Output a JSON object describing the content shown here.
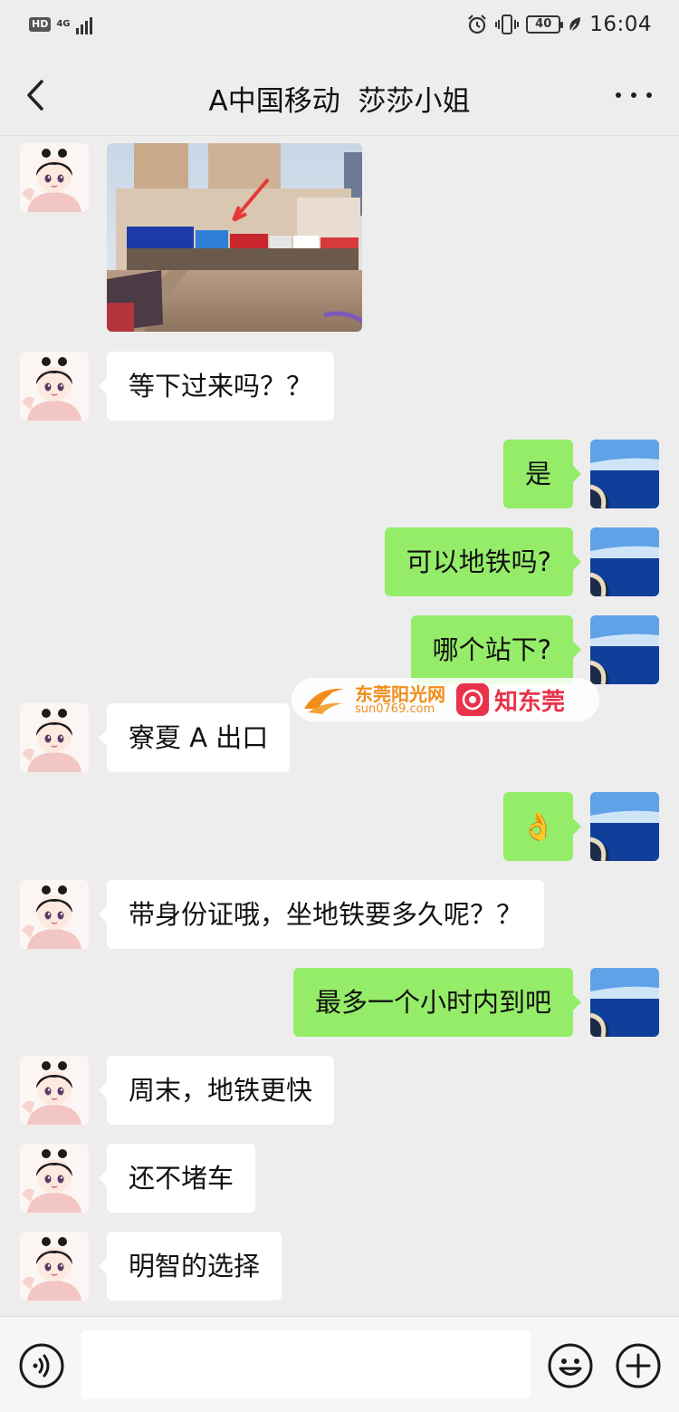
{
  "status_bar": {
    "hd": "HD",
    "network": "4G",
    "battery": "40",
    "time": "16:04"
  },
  "header": {
    "title": "A中国移动  莎莎小姐"
  },
  "messages": {
    "m2": "等下过来吗？？",
    "m3": "是",
    "m4": "可以地铁吗?",
    "m5": "哪个站下?",
    "m6": "寮夏 A 出口",
    "m7": "👌",
    "m8": "带身份证哦，坐地铁要多久呢？？",
    "m9": "最多一个小时内到吧",
    "m10": "周末，地铁更快",
    "m11": "还不堵车",
    "m12": "明智的选择"
  },
  "watermark": {
    "site": "东莞阳光网",
    "url": "sun0769.com",
    "brand": "知东莞"
  },
  "input": {
    "value": "",
    "placeholder": ""
  },
  "colors": {
    "background": "#ededed",
    "incoming_bubble": "#ffffff",
    "outgoing_bubble": "#95ec69",
    "watermark_orange": "#f28c1a",
    "watermark_red": "#e8334a"
  },
  "icons": [
    "back-arrow-icon",
    "more-dots-icon",
    "voice-icon",
    "emoji-icon",
    "plus-icon",
    "battery-icon",
    "alarm-icon",
    "vibrate-icon",
    "leaf-icon",
    "signal-icon"
  ]
}
